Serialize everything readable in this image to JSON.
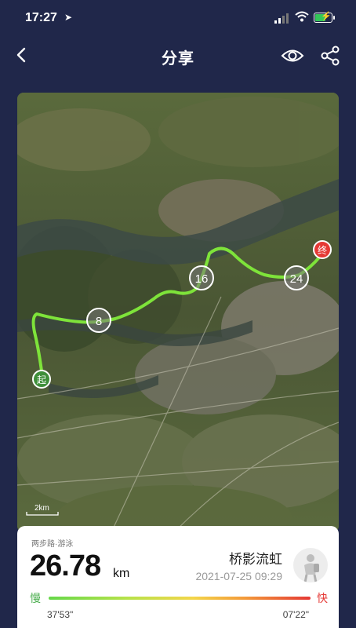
{
  "status_bar": {
    "time": "17:27",
    "battery_level": 0.7
  },
  "nav": {
    "title": "分享"
  },
  "map": {
    "scale_label": "2km",
    "start_label": "起",
    "end_label": "终",
    "markers": [
      "8",
      "16",
      "24"
    ],
    "route_color": "#7ee33a",
    "end_color": "#e53935",
    "start_color": "#3f8f3a"
  },
  "activity": {
    "category": "两步路·游泳",
    "distance": "26.78",
    "unit": "km",
    "user_name": "桥影流虹",
    "datetime": "2021-07-25 09:29",
    "slow_label": "慢",
    "fast_label": "快",
    "pace_slow": "37'53\"",
    "pace_fast": "07'22\""
  }
}
